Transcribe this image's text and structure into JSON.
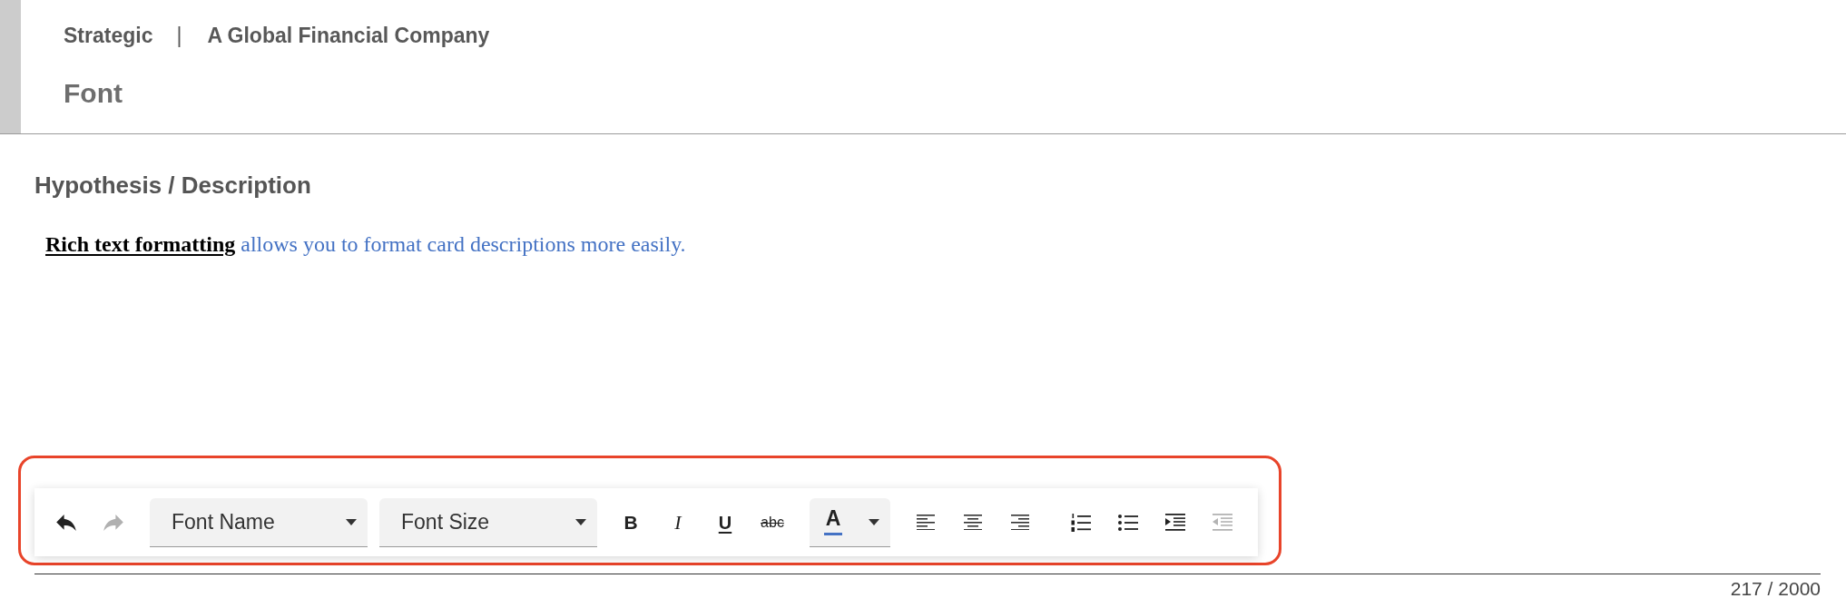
{
  "header": {
    "breadcrumb": [
      {
        "label": "Strategic"
      },
      {
        "label": "A Global Financial Company"
      }
    ],
    "separator": "|",
    "title": "Font"
  },
  "section": {
    "heading": "Hypothesis / Description",
    "content": [
      {
        "text": "Rich text formatting",
        "bold": true,
        "underline": true,
        "color": "#000000"
      },
      {
        "text": "allows you to format card descriptions more easily.",
        "bold": false,
        "underline": false,
        "color": "#4472c4"
      }
    ]
  },
  "toolbar": {
    "highlighted": true,
    "history": [
      {
        "kind": "undo",
        "disabled": false
      },
      {
        "kind": "redo",
        "disabled": true
      }
    ],
    "dropdowns": [
      {
        "label": "Font Name"
      },
      {
        "label": "Font Size"
      }
    ],
    "styles": [
      {
        "kind": "bold",
        "label": "B"
      },
      {
        "kind": "italic",
        "label": "I"
      },
      {
        "kind": "underline",
        "label": "U"
      },
      {
        "kind": "strikethrough",
        "label": "abc"
      }
    ],
    "font_color": {
      "label": "A",
      "color": "#4472c4"
    },
    "alignment": [
      {
        "kind": "left"
      },
      {
        "kind": "center"
      },
      {
        "kind": "right"
      }
    ],
    "lists": [
      {
        "kind": "numbered",
        "disabled": false
      },
      {
        "kind": "bulleted",
        "disabled": false
      },
      {
        "kind": "indent",
        "disabled": false
      },
      {
        "kind": "outdent",
        "disabled": true
      }
    ]
  },
  "character_count": "217 / 2000"
}
